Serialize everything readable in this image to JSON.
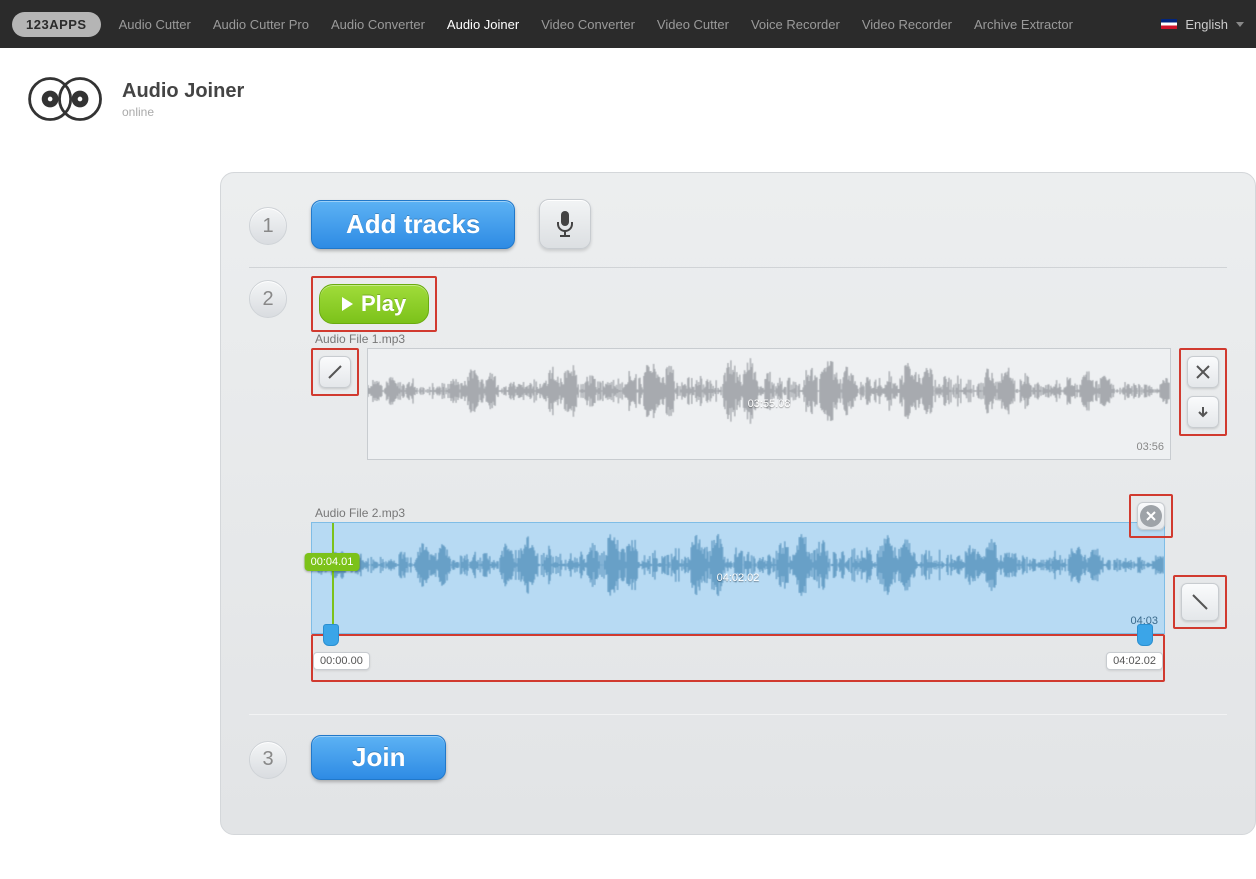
{
  "brand": "123APPS",
  "nav": [
    {
      "label": "Audio Cutter",
      "active": false
    },
    {
      "label": "Audio Cutter Pro",
      "active": false
    },
    {
      "label": "Audio Converter",
      "active": false
    },
    {
      "label": "Audio Joiner",
      "active": true
    },
    {
      "label": "Video Converter",
      "active": false
    },
    {
      "label": "Video Cutter",
      "active": false
    },
    {
      "label": "Voice Recorder",
      "active": false
    },
    {
      "label": "Video Recorder",
      "active": false
    },
    {
      "label": "Archive Extractor",
      "active": false
    }
  ],
  "language": "English",
  "app": {
    "title": "Audio Joiner",
    "subtitle": "online"
  },
  "step1": {
    "num": "1",
    "add_label": "Add tracks"
  },
  "step2": {
    "num": "2",
    "play_label": "Play",
    "track1": {
      "name": "Audio File 1.mp3",
      "mid": "03:55.08",
      "total": "03:56"
    },
    "track2": {
      "name": "Audio File 2.mp3",
      "mid": "04:02.02",
      "total": "04:03",
      "playhead": "00:04.01",
      "start": "00:00.00",
      "end": "04:02.02"
    }
  },
  "step3": {
    "num": "3",
    "join_label": "Join"
  }
}
